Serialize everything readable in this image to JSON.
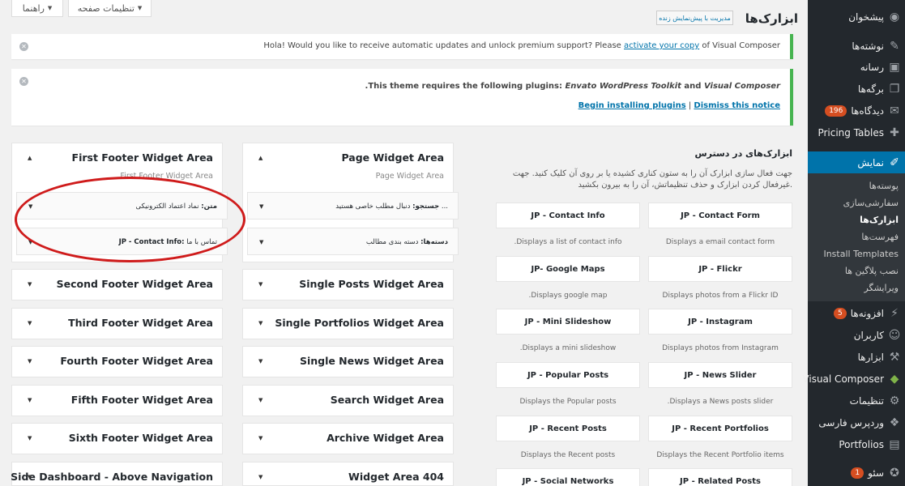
{
  "screen_meta": {
    "screen_options_label": "تنظیمات صفحه",
    "help_label": "راهنما"
  },
  "header": {
    "title": "ابزارک‌ها",
    "manage_live_preview": "مدیریت با پیش‌نمایش زنده"
  },
  "notices": {
    "vc": {
      "text_before": "Hola! Would you like to receive automatic updates and unlock premium support? Please ",
      "link": "activate your copy",
      "text_after": " of Visual Composer"
    },
    "tgm": {
      "text_before": ".This theme requires the following plugins: ",
      "plugin1": "Envato WordPress Toolkit",
      "and": " and ",
      "plugin2": "Visual Composer",
      "begin_link": "Begin installing plugins",
      "separator": "|",
      "dismiss_link": "Dismiss this notice"
    }
  },
  "sidebar_menu": {
    "items": [
      {
        "label": "پیشخوان",
        "icon": "dashboard-icon"
      },
      {
        "label": "نوشته‌ها",
        "icon": "pin-icon"
      },
      {
        "label": "رسانه",
        "icon": "media-icon"
      },
      {
        "label": "برگه‌ها",
        "icon": "pages-icon"
      },
      {
        "label": "دیدگاه‌ها",
        "icon": "comments-icon",
        "badge": "196"
      },
      {
        "label": "Pricing Tables",
        "icon": "plus-icon"
      },
      {
        "label": "نمایش",
        "icon": "brush-icon",
        "active": true
      }
    ],
    "submenu": [
      "پوسته‌ها",
      "سفارشی‌سازی",
      "ابزارک‌ها",
      "فهرست‌ها",
      "Install Templates",
      "نصب پلاگین ها",
      "ویرایشگر"
    ],
    "items_after": [
      {
        "label": "افزونه‌ها",
        "icon": "plugin-icon",
        "badge": "5"
      },
      {
        "label": "کاربران",
        "icon": "users-icon"
      },
      {
        "label": "ابزارها",
        "icon": "tools-icon"
      },
      {
        "label": "Visual Composer",
        "icon": "vc-icon"
      },
      {
        "label": "تنظیمات",
        "icon": "settings-icon"
      },
      {
        "label": "وردپرس فارسی",
        "icon": "wp-fa-icon"
      },
      {
        "label": "Portfolios",
        "icon": "folder-icon"
      },
      {
        "label": "سئو",
        "icon": "seo-icon",
        "badge": "1"
      }
    ]
  },
  "available_widgets": {
    "title": "ابزارک‌های در دسترس",
    "description": "جهت فعال سازی ابزارک آن را به ستون کناری کشیده یا بر روی آن کلیک کنید. جهت غیرفعال کردن ابزارک و حذف تنظیماتش، آن را به بیرون بکشید.",
    "widgets": [
      {
        "name": "JP - Contact Form",
        "desc": "Displays a email contact form"
      },
      {
        "name": "JP - Contact Info",
        "desc": ".Displays a list of contact info"
      },
      {
        "name": "JP - Flickr",
        "desc": "Displays photos from a Flickr ID"
      },
      {
        "name": "JP- Google Maps",
        "desc": ".Displays google map"
      },
      {
        "name": "JP - Instagram",
        "desc": "Displays photos from Instagram"
      },
      {
        "name": "JP - Mini Slideshow",
        "desc": ".Displays a mini slideshow"
      },
      {
        "name": "JP - News Slider",
        "desc": ".Displays a News posts slider"
      },
      {
        "name": "JP - Popular Posts",
        "desc": "Displays the Popular posts"
      },
      {
        "name": "JP - Recent Portfolios",
        "desc": "Displays the Recent Portfolio items"
      },
      {
        "name": "JP - Recent Posts",
        "desc": "Displays the Recent posts"
      },
      {
        "name": "JP - Related Posts",
        "desc": ""
      },
      {
        "name": "JP - Social Networks",
        "desc": ""
      }
    ]
  },
  "widget_areas": {
    "page": {
      "title": "Page Widget Area",
      "desc": "Page Widget Area",
      "widgets": [
        {
          "label": "جستجو:",
          "sub": " دنبال مطلب خاصی هستید ..."
        },
        {
          "label": "دسته‌ها:",
          "sub": " دسته بندی مطالب"
        }
      ]
    },
    "first_footer": {
      "title": "First Footer Widget Area",
      "desc": "First Footer Widget Area",
      "widgets": [
        {
          "label": "متن:",
          "sub": " نماد اعتماد الکترونیکی"
        },
        {
          "label": "JP - Contact Info:",
          "sub": " تماس با ما"
        }
      ]
    },
    "left_column": [
      "Second Footer Widget Area",
      "Third Footer Widget Area",
      "Fourth Footer Widget Area",
      "Fifth Footer Widget Area",
      "Sixth Footer Widget Area",
      "Side Dashboard - Above Navigation"
    ],
    "right_column": [
      "Single Posts Widget Area",
      "Single Portfolios Widget Area",
      "Single News Widget Area",
      "Search Widget Area",
      "Archive Widget Area",
      "Widget Area 404"
    ]
  },
  "colors": {
    "sidebar_bg": "#23282d",
    "active_menu": "#0073aa",
    "notice_border": "#46b450",
    "link": "#0073aa",
    "badge": "#d54e21",
    "annotation": "#cf1b1b"
  }
}
